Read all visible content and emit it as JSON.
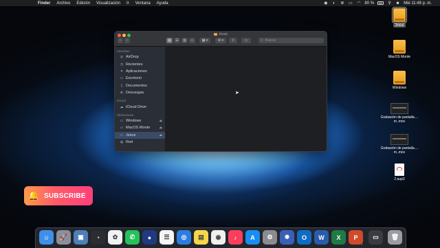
{
  "menubar": {
    "apple": "",
    "menus": [
      "Finder",
      "Archivo",
      "Edición",
      "Visualización",
      "Ir",
      "Ventana",
      "Ayuda"
    ],
    "battery": "80 %",
    "clock": "Mié 11:48 p. m."
  },
  "finder": {
    "title": "Jesus",
    "search_placeholder": "Buscar",
    "sidebar": {
      "favoritos_label": "Favoritos",
      "favoritos": [
        "AirDrop",
        "Recientes",
        "Aplicaciones",
        "Escritorio",
        "Documentos",
        "Descargas"
      ],
      "icloud_label": "iCloud",
      "icloud": [
        "iCloud Drive"
      ],
      "ubicaciones_label": "Ubicaciones",
      "ubicaciones": [
        "Windows",
        "MacOS Monte",
        "Jesus",
        "Red"
      ]
    }
  },
  "desktop": {
    "items": [
      "Jesus",
      "MacOS Monte",
      "Windows",
      "Grabación de pantalla.... m..mov",
      "Grabación de pantalla.... m..mov",
      "2.aup3"
    ]
  },
  "subscribe": {
    "label": "SUBSCRIBE"
  },
  "dock": {
    "items": [
      {
        "icon": "finder-icon",
        "color": "#3f8ee8",
        "glyph": "☺"
      },
      {
        "icon": "launchpad-icon",
        "color": "#8a8f99",
        "glyph": "🚀"
      },
      {
        "icon": "preview-icon",
        "color": "#4d7fb8",
        "glyph": "▣"
      },
      {
        "icon": "activity-monitor-icon",
        "color": "#2b2d33",
        "glyph": "◔"
      },
      {
        "icon": "photos-icon",
        "color": "#f2f2f2",
        "glyph": "✿"
      },
      {
        "icon": "whatsapp-icon",
        "color": "#25c15a",
        "glyph": "✆"
      },
      {
        "icon": "paint-icon",
        "color": "#1f3a80",
        "glyph": "●"
      },
      {
        "icon": "reminders-icon",
        "color": "#f5f5f5",
        "glyph": "☰"
      },
      {
        "icon": "safari-icon",
        "color": "#2b7de0",
        "glyph": "◎"
      },
      {
        "icon": "notes-icon",
        "color": "#f8d64a",
        "glyph": "▤"
      },
      {
        "icon": "chrome-icon",
        "color": "#f0f0f0",
        "glyph": "◉"
      },
      {
        "icon": "music-icon",
        "color": "#fa3e5c",
        "glyph": "♪"
      },
      {
        "icon": "app-store-icon",
        "color": "#1a8df0",
        "glyph": "A"
      },
      {
        "icon": "system-preferences-icon",
        "color": "#8b8b90",
        "glyph": "⚙"
      },
      {
        "icon": "settings-gear-icon",
        "color": "#3b5fb8",
        "glyph": "✹"
      },
      {
        "icon": "outlook-icon",
        "color": "#0f6cc4",
        "glyph": "O"
      },
      {
        "icon": "word-icon",
        "color": "#2a5cab",
        "glyph": "W"
      },
      {
        "icon": "excel-icon",
        "color": "#1f7a45",
        "glyph": "X"
      },
      {
        "icon": "powerpoint-icon",
        "color": "#cf4a2a",
        "glyph": "P"
      },
      {
        "icon": "screen-recording-icon",
        "color": "#3a3c42",
        "glyph": "▭"
      },
      {
        "icon": "trash-icon",
        "color": "#9a9ca2",
        "glyph": "🗑"
      }
    ]
  }
}
